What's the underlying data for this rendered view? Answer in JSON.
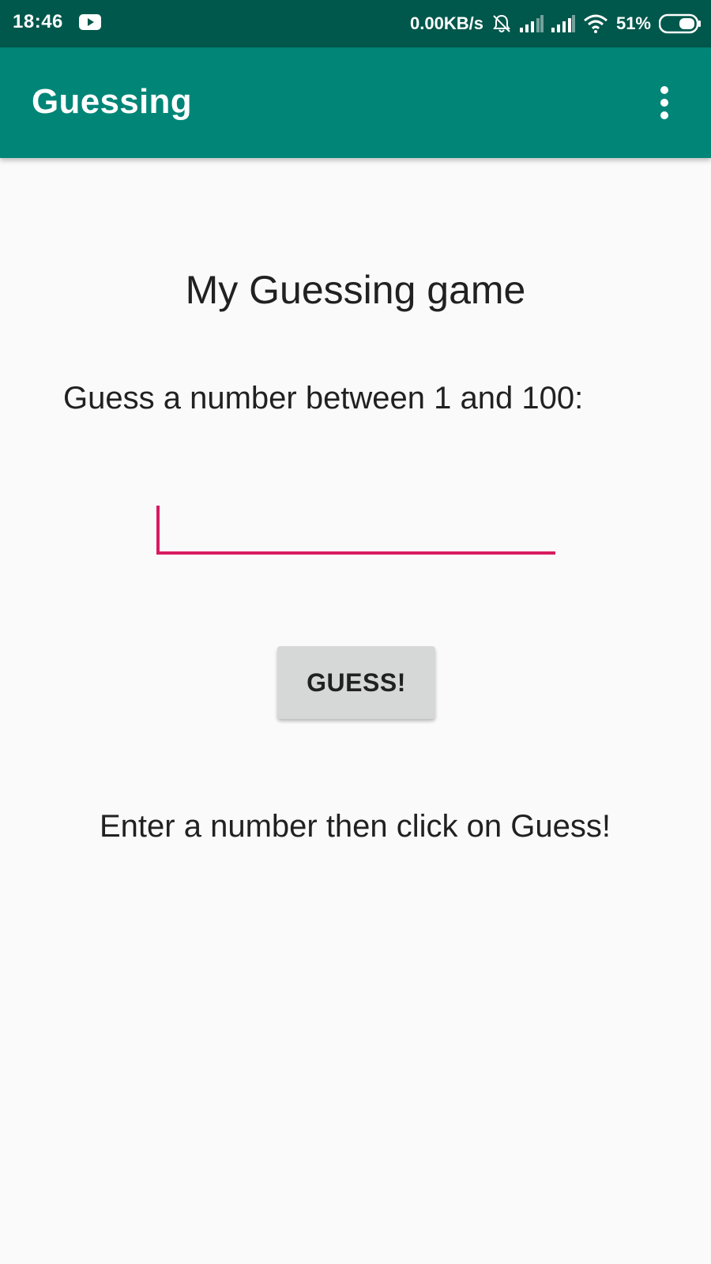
{
  "status_bar": {
    "time": "18:46",
    "net_speed": "0.00KB/s",
    "battery": "51%",
    "icons": [
      "youtube-icon",
      "bell-muted-icon",
      "signal-icon",
      "signal-icon",
      "wifi-icon",
      "battery-icon"
    ]
  },
  "app_bar": {
    "title": "Guessing",
    "menu_icon": "more-vertical-icon",
    "background": "#008577"
  },
  "content": {
    "heading": "My Guessing game",
    "prompt": "Guess a number between 1 and 100:",
    "input": {
      "value": "",
      "placeholder": ""
    },
    "button_label": "GUESS!",
    "message": "Enter a number then click on Guess!"
  },
  "colors": {
    "status_bar": "#00574b",
    "accent": "#d81b60",
    "background": "#fafafa",
    "button": "#d6d7d7"
  }
}
